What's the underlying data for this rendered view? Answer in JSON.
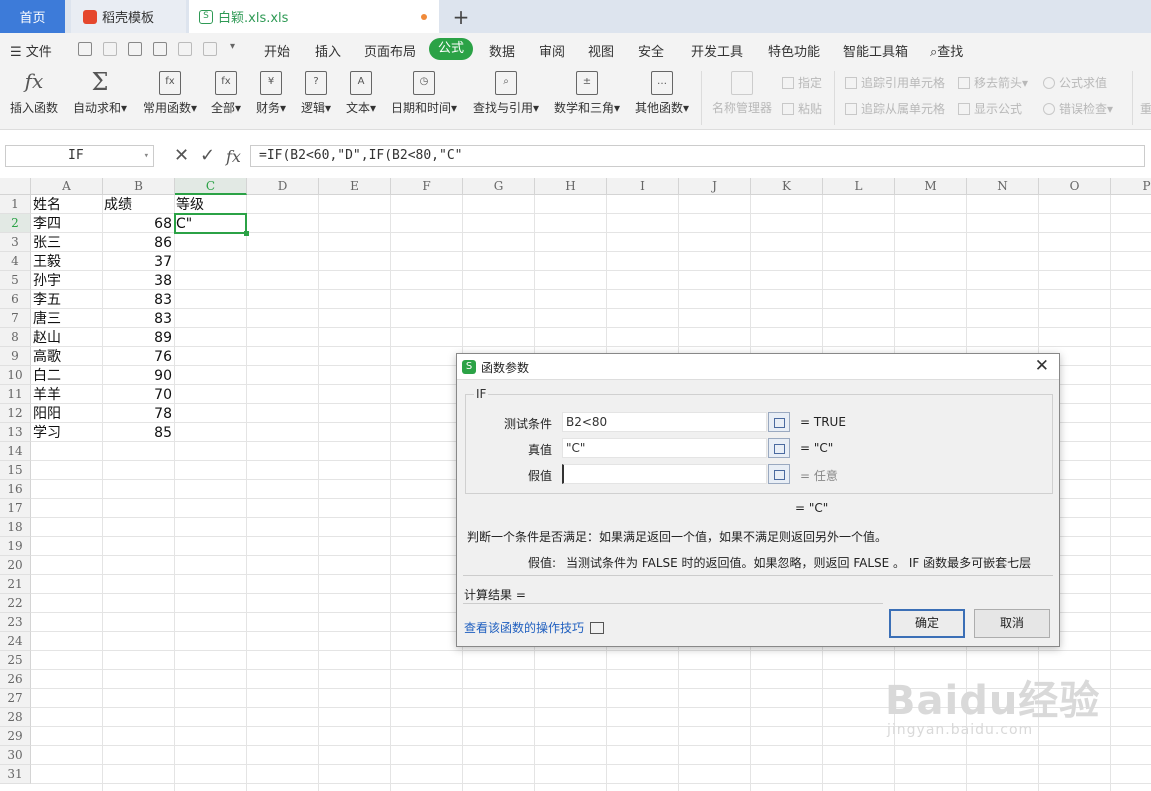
{
  "tabs": {
    "home": "首页",
    "template": "稻壳模板",
    "file": "白颖.xls.xls",
    "add": "+"
  },
  "menu": {
    "file": "文件",
    "items": [
      "开始",
      "插入",
      "页面布局",
      "公式",
      "数据",
      "审阅",
      "视图",
      "安全",
      "开发工具",
      "特色功能",
      "智能工具箱",
      "查找"
    ],
    "active": "公式"
  },
  "ribbon": {
    "insert_function": "插入函数",
    "autosum": "自动求和",
    "common": "常用函数",
    "all": "全部",
    "finance": "财务",
    "logic": "逻辑",
    "text": "文本",
    "datetime": "日期和时间",
    "lookup": "查找与引用",
    "math": "数学和三角",
    "other": "其他函数",
    "name_manager": "名称管理器",
    "define": "指定",
    "paste": "粘贴",
    "trace_precedents": "追踪引用单元格",
    "trace_dependents": "追踪从属单元格",
    "remove_arrows": "移去箭头",
    "show_formulas": "显示公式",
    "evaluate": "公式求值",
    "error_check": "错误检查",
    "recalc": "重"
  },
  "formula_bar": {
    "name_box": "IF",
    "fx": "fx",
    "formula": "=IF(B2<60,\"D\",IF(B2<80,\"C\""
  },
  "grid": {
    "columns": [
      "A",
      "B",
      "C",
      "D",
      "E",
      "F",
      "G",
      "H",
      "I",
      "J",
      "K",
      "L",
      "M",
      "N",
      "O",
      "P"
    ],
    "rows": [
      "1",
      "2",
      "3",
      "4",
      "5",
      "6",
      "7",
      "8",
      "9",
      "10",
      "11",
      "12",
      "13",
      "14",
      "15",
      "16",
      "17",
      "18",
      "19",
      "20",
      "21",
      "22",
      "23",
      "24",
      "25",
      "26",
      "27",
      "28",
      "29",
      "30",
      "31"
    ],
    "header": {
      "a": "姓名",
      "b": "成绩",
      "c": "等级"
    },
    "names": [
      "李四",
      "张三",
      "王毅",
      "孙宇",
      "李五",
      "唐三",
      "赵山",
      "高歌",
      "白二",
      "羊羊",
      "阳阳",
      "学习"
    ],
    "scores": [
      "68",
      "86",
      "37",
      "38",
      "83",
      "83",
      "89",
      "76",
      "90",
      "70",
      "78",
      "85"
    ],
    "c2": "C\""
  },
  "dialog": {
    "title": "函数参数",
    "function": "IF",
    "params": [
      {
        "label": "测试条件",
        "value": "B2<80",
        "result": "= TRUE"
      },
      {
        "label": "真值",
        "value": "\"C\"",
        "result": "= \"C\""
      },
      {
        "label": "假值",
        "value": "",
        "result": "= 任意"
      }
    ],
    "formula_result": "= \"C\"",
    "description": "判断一个条件是否满足：如果满足返回一个值，如果不满足则返回另外一个值。",
    "param_help_label": "假值:",
    "param_help": "当测试条件为 FALSE 时的返回值。如果忽略，则返回 FALSE 。 IF 函数最多可嵌套七层",
    "calc_result": "计算结果 =",
    "help_link": "查看该函数的操作技巧",
    "ok": "确定",
    "cancel": "取消"
  },
  "watermark": {
    "brand": "Baidu经验",
    "url": "jingyan.baidu.com"
  }
}
